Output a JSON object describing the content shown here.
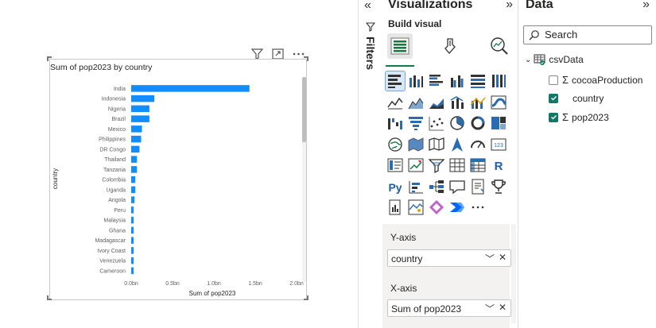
{
  "chart_data": {
    "type": "bar",
    "orientation": "horizontal",
    "title": "Sum of pop2023 by country",
    "xlabel": "Sum of pop2023",
    "ylabel": "country",
    "categories": [
      "India",
      "Indonesia",
      "Nigeria",
      "Brazil",
      "Mexico",
      "Philippines",
      "DR Congo",
      "Thailand",
      "Tanzania",
      "Colombia",
      "Uganda",
      "Angola",
      "Peru",
      "Malaysia",
      "Ghana",
      "Madagascar",
      "Ivory Coast",
      "Venezuela",
      "Cameroon"
    ],
    "values": [
      1.43,
      0.28,
      0.22,
      0.22,
      0.13,
      0.12,
      0.1,
      0.07,
      0.07,
      0.05,
      0.05,
      0.04,
      0.03,
      0.03,
      0.03,
      0.03,
      0.03,
      0.03,
      0.03
    ],
    "value_unit": "bn",
    "xlim": [
      0,
      2.0
    ],
    "x_ticks": [
      "0.0bn",
      "0.5bn",
      "1.0bn",
      "1.5bn",
      "2.0bn"
    ],
    "bar_color": "#118dff",
    "grid": false,
    "legend": "none"
  },
  "filters": {
    "label": "Filters"
  },
  "visualizations": {
    "title": "Visualizations",
    "build_label": "Build visual",
    "modes": [
      "build-visual-icon",
      "format-visual-icon",
      "analytics-icon"
    ],
    "icons": [
      "stacked-bar-chart-icon",
      "stacked-column-chart-icon",
      "clustered-bar-chart-icon",
      "clustered-column-chart-icon",
      "100-stacked-bar-chart-icon",
      "100-stacked-column-chart-icon",
      "line-chart-icon",
      "area-chart-icon",
      "stacked-area-chart-icon",
      "line-and-column-chart-icon",
      "line-and-clustered-column-icon",
      "ribbon-chart-icon",
      "waterfall-chart-icon",
      "funnel-icon",
      "scatter-chart-icon",
      "pie-chart-icon",
      "donut-chart-icon",
      "treemap-icon",
      "map-icon",
      "filled-map-icon",
      "shape-map-icon",
      "azure-map-icon",
      "gauge-icon",
      "card-icon",
      "multi-row-card-icon",
      "kpi-icon",
      "slicer-icon",
      "table-icon",
      "matrix-icon",
      "r-visual-icon",
      "python-visual-icon",
      "key-influencers-icon",
      "decomposition-tree-icon",
      "qna-icon",
      "smart-narrative-icon",
      "trophy-icon",
      "paginated-report-icon",
      "arcgis-map-icon",
      "power-apps-icon",
      "power-automate-icon",
      "more-icon"
    ],
    "more_glyph": "···",
    "y_axis": {
      "label": "Y-axis",
      "field": "country"
    },
    "x_axis": {
      "label": "X-axis",
      "field": "Sum of pop2023"
    },
    "selected_color": "#d9e8f6",
    "accent": "#107c41"
  },
  "data_pane": {
    "title": "Data",
    "search_placeholder": "Search",
    "table": "csvData",
    "fields": [
      {
        "name": "cocoaProduction",
        "checked": false,
        "sigma": true
      },
      {
        "name": "country",
        "checked": true,
        "sigma": false
      },
      {
        "name": "pop2023",
        "checked": true,
        "sigma": true
      }
    ],
    "check_color": "#117865"
  }
}
